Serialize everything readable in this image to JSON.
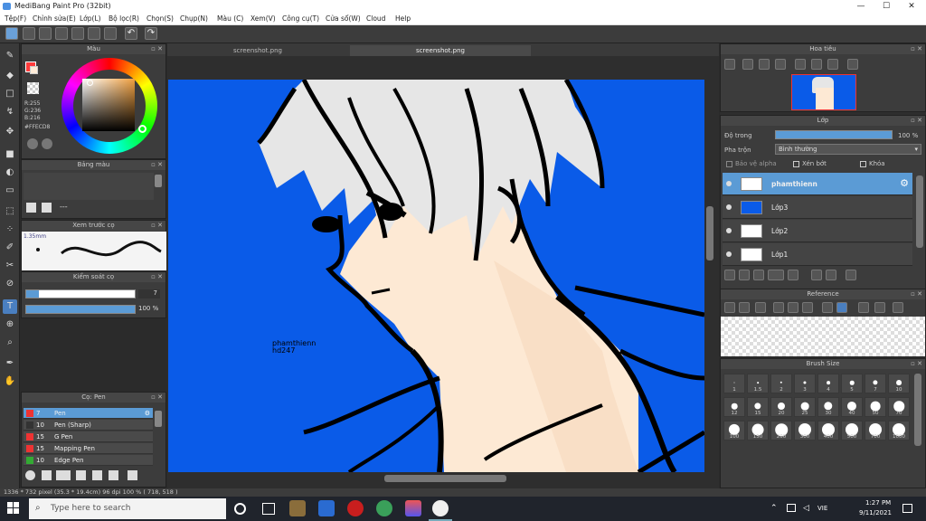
{
  "window": {
    "title": "MediBang Paint Pro (32bit)",
    "minimize": "—",
    "maximize": "☐",
    "close": "✕"
  },
  "menu": [
    "Tệp(F)",
    "Chỉnh sửa(E)",
    "Lớp(L)",
    "Bộ lọc(R)",
    "Chọn(S)",
    "Chụp(N)",
    "Màu (C)",
    "Xem(V)",
    "Công cụ(T)",
    "Cửa sổ(W)",
    "Cloud",
    "Help"
  ],
  "tabs": [
    "screenshot.png",
    "screenshot.png"
  ],
  "color_panel": {
    "title": "Màu",
    "r": "R:255",
    "g": "G:236",
    "b": "B:216",
    "hex": "#FFECD8",
    "fg_color": "#ff3b3b",
    "current_color": "#FFECD8"
  },
  "palette_panel": {
    "title": "Bảng màu",
    "dash": "---"
  },
  "preview_panel": {
    "title": "Xem trước cọ",
    "size": "1.35mm"
  },
  "brush_control": {
    "title": "Kiểm soát cọ",
    "size_value": "7",
    "opacity_value": "100 %"
  },
  "brush_list": {
    "title": "Cọ: Pen",
    "items": [
      {
        "size": "7",
        "name": "Pen",
        "color": "#e33",
        "selected": true
      },
      {
        "size": "10",
        "name": "Pen (Sharp)",
        "color": "#333",
        "selected": false
      },
      {
        "size": "15",
        "name": "G Pen",
        "color": "#e33",
        "selected": false
      },
      {
        "size": "15",
        "name": "Mapping Pen",
        "color": "#e33",
        "selected": false
      },
      {
        "size": "10",
        "name": "Edge Pen",
        "color": "#3a3",
        "selected": false
      }
    ]
  },
  "navigator": {
    "title": "Hoa tiêu"
  },
  "layer_panel": {
    "title": "Lớp",
    "opacity_label": "Độ trong",
    "opacity_value": "100 %",
    "blend_label": "Pha trộn",
    "blend_value": "Bình thường",
    "protect_alpha": "Bảo vệ alpha",
    "clipping": "Xén bớt",
    "lock": "Khóa",
    "layers": [
      {
        "name": "phamthienn",
        "selected": true
      },
      {
        "name": "Lớp3",
        "selected": false
      },
      {
        "name": "Lớp2",
        "selected": false
      },
      {
        "name": "Lớp1",
        "selected": false
      }
    ]
  },
  "reference_panel": {
    "title": "Reference"
  },
  "brush_size_panel": {
    "title": "Brush Size",
    "sizes": [
      "1",
      "1.5",
      "2",
      "3",
      "4",
      "5",
      "7",
      "10",
      "12",
      "15",
      "20",
      "25",
      "30",
      "40",
      "50",
      "70",
      "100",
      "150",
      "200",
      "300",
      "400",
      "500",
      "700",
      "1000"
    ]
  },
  "canvas_text": {
    "line1": "phamthienn",
    "line2": "hd247",
    "bg": "#0a5be8"
  },
  "status": {
    "text": "1336 * 732 pixel   (35.3 * 19.4cm)  96 dpi  100 %  ( 718, 518 )"
  },
  "taskbar": {
    "search_placeholder": "Type here to search",
    "lang": "VIE",
    "time": "1:27 PM",
    "date": "9/11/2021"
  }
}
